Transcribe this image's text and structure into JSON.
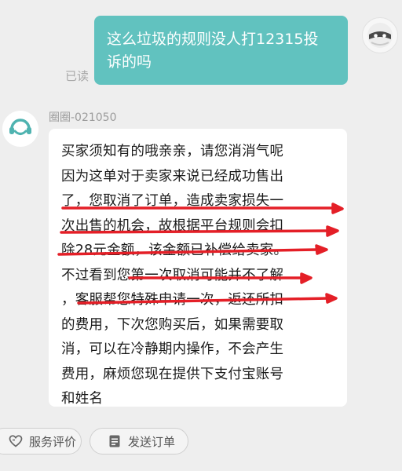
{
  "conversation": {
    "outgoing": {
      "lines": [
        "这么垃圾的规则没人打12315投",
        "诉的吗"
      ],
      "read_status": "已读"
    },
    "agent": {
      "name": "圈圈-021050",
      "reply_lines": [
        "买家须知有的哦亲亲，请您消消气呢",
        "因为这单对于卖家来说已经成功售出",
        "了，您取消了订单，造成卖家损失一",
        "次出售的机会，故根据平台规则会扣",
        "除28元金额，该金额已补偿给卖家。",
        "不过看到您第一次取消可能并不了解",
        "，客服帮您特殊申请一次，返还所扣",
        "的费用，下次您购买后，如果需要取",
        "消，可以在冷静期内操作，不会产生",
        "费用，麻烦您现在提供下支付宝账号",
        "和姓名"
      ]
    }
  },
  "bottom_bar": {
    "service_rating": {
      "label": "服务评价",
      "icon": "heart-icon"
    },
    "send_order": {
      "label": "发送订单",
      "icon": "document-icon"
    }
  },
  "colors": {
    "outgoing_bubble": "#61c2bf",
    "annotation_red": "#e41f27",
    "background": "#eeeeee"
  }
}
